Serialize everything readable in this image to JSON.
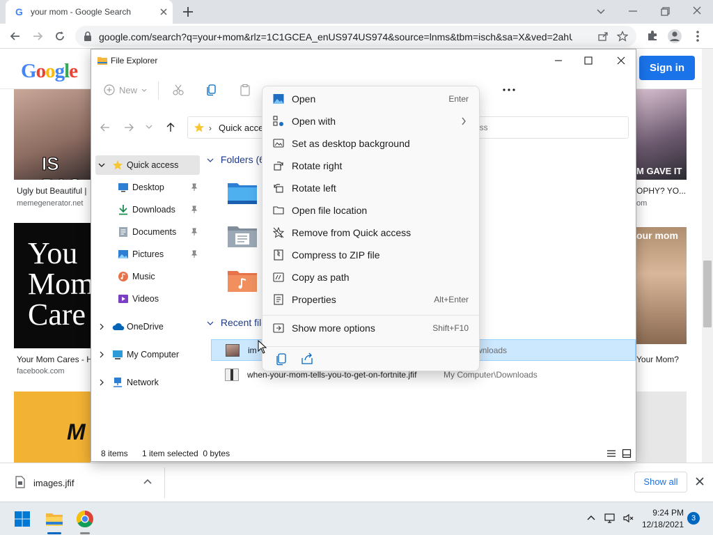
{
  "browser": {
    "tab_title": "your mom - Google Search",
    "tab_favicon": "G",
    "url": "google.com/search?q=your+mom&rlz=1C1GCEA_enUS974US974&source=lnms&tbm=isch&sa=X&ved=2ahUK...",
    "signin_label": "Sign in",
    "logo_letters": [
      "G",
      "o",
      "o",
      "g",
      "l",
      "e"
    ],
    "logo_colors": [
      "#4285f4",
      "#ea4335",
      "#fbbc05",
      "#4285f4",
      "#34a853",
      "#ea4335"
    ]
  },
  "results": {
    "left_col": [
      {
        "caption": "Ugly but Beautiful |",
        "source": "memegenerator.net",
        "overlay": "IS BAC"
      },
      {
        "caption": "Your Mom Cares - H",
        "source": "facebook.com",
        "overlay_lines": [
          "You",
          "Mom",
          "Care"
        ]
      },
      {
        "overlay": "M"
      }
    ],
    "right_col": [
      {
        "caption": "OPHY? YO...",
        "source": "om",
        "overlay": "M GAVE IT"
      },
      {
        "caption": "Your Mom?",
        "overlay": "our mom"
      }
    ]
  },
  "downloads": {
    "filename": "images.jfif",
    "show_all": "Show all"
  },
  "taskbar": {
    "time": "9:24 PM",
    "date": "12/18/2021",
    "notification_count": "3"
  },
  "explorer": {
    "title": "File Explorer",
    "new_label": "New",
    "address": "Quick access",
    "search_placeholder": "ess",
    "nav": [
      {
        "label": "Quick access",
        "icon": "star-icon",
        "selected": true
      },
      {
        "label": "Desktop",
        "icon": "desktop-icon",
        "pinned": true
      },
      {
        "label": "Downloads",
        "icon": "download-icon",
        "pinned": true
      },
      {
        "label": "Documents",
        "icon": "documents-icon",
        "pinned": true
      },
      {
        "label": "Pictures",
        "icon": "pictures-icon",
        "pinned": true
      },
      {
        "label": "Music",
        "icon": "music-icon"
      },
      {
        "label": "Videos",
        "icon": "videos-icon"
      },
      {
        "label": "OneDrive",
        "icon": "onedrive-icon"
      },
      {
        "label": "My Computer",
        "icon": "computer-icon"
      },
      {
        "label": "Network",
        "icon": "network-icon"
      }
    ],
    "folders_header": "Folders (6",
    "recent_header": "Recent file",
    "recent_files": [
      {
        "name": "im",
        "path": "puter\\Downloads",
        "selected": true
      },
      {
        "name": "when-your-mom-tells-you-to-get-on-fortnite.jfif",
        "path": "My Computer\\Downloads",
        "selected": false
      }
    ],
    "status": {
      "items": "8 items",
      "selection": "1 item selected  0 bytes"
    }
  },
  "context_menu": {
    "items": [
      {
        "label": "Open",
        "shortcut": "Enter",
        "icon": "image-icon"
      },
      {
        "label": "Open with",
        "shortcut": "",
        "icon": "open-with-icon",
        "submenu": true
      },
      {
        "label": "Set as desktop background",
        "shortcut": "",
        "icon": "wallpaper-icon"
      },
      {
        "label": "Rotate right",
        "shortcut": "",
        "icon": "rotate-right-icon"
      },
      {
        "label": "Rotate left",
        "shortcut": "",
        "icon": "rotate-left-icon"
      },
      {
        "label": "Open file location",
        "shortcut": "",
        "icon": "folder-icon"
      },
      {
        "label": "Remove from Quick access",
        "shortcut": "",
        "icon": "unpin-star-icon"
      },
      {
        "label": "Compress to ZIP file",
        "shortcut": "",
        "icon": "zip-icon"
      },
      {
        "label": "Copy as path",
        "shortcut": "",
        "icon": "copy-path-icon"
      },
      {
        "label": "Properties",
        "shortcut": "Alt+Enter",
        "icon": "properties-icon"
      },
      {
        "label": "Show more options",
        "shortcut": "Shift+F10",
        "icon": "more-options-icon"
      }
    ]
  }
}
